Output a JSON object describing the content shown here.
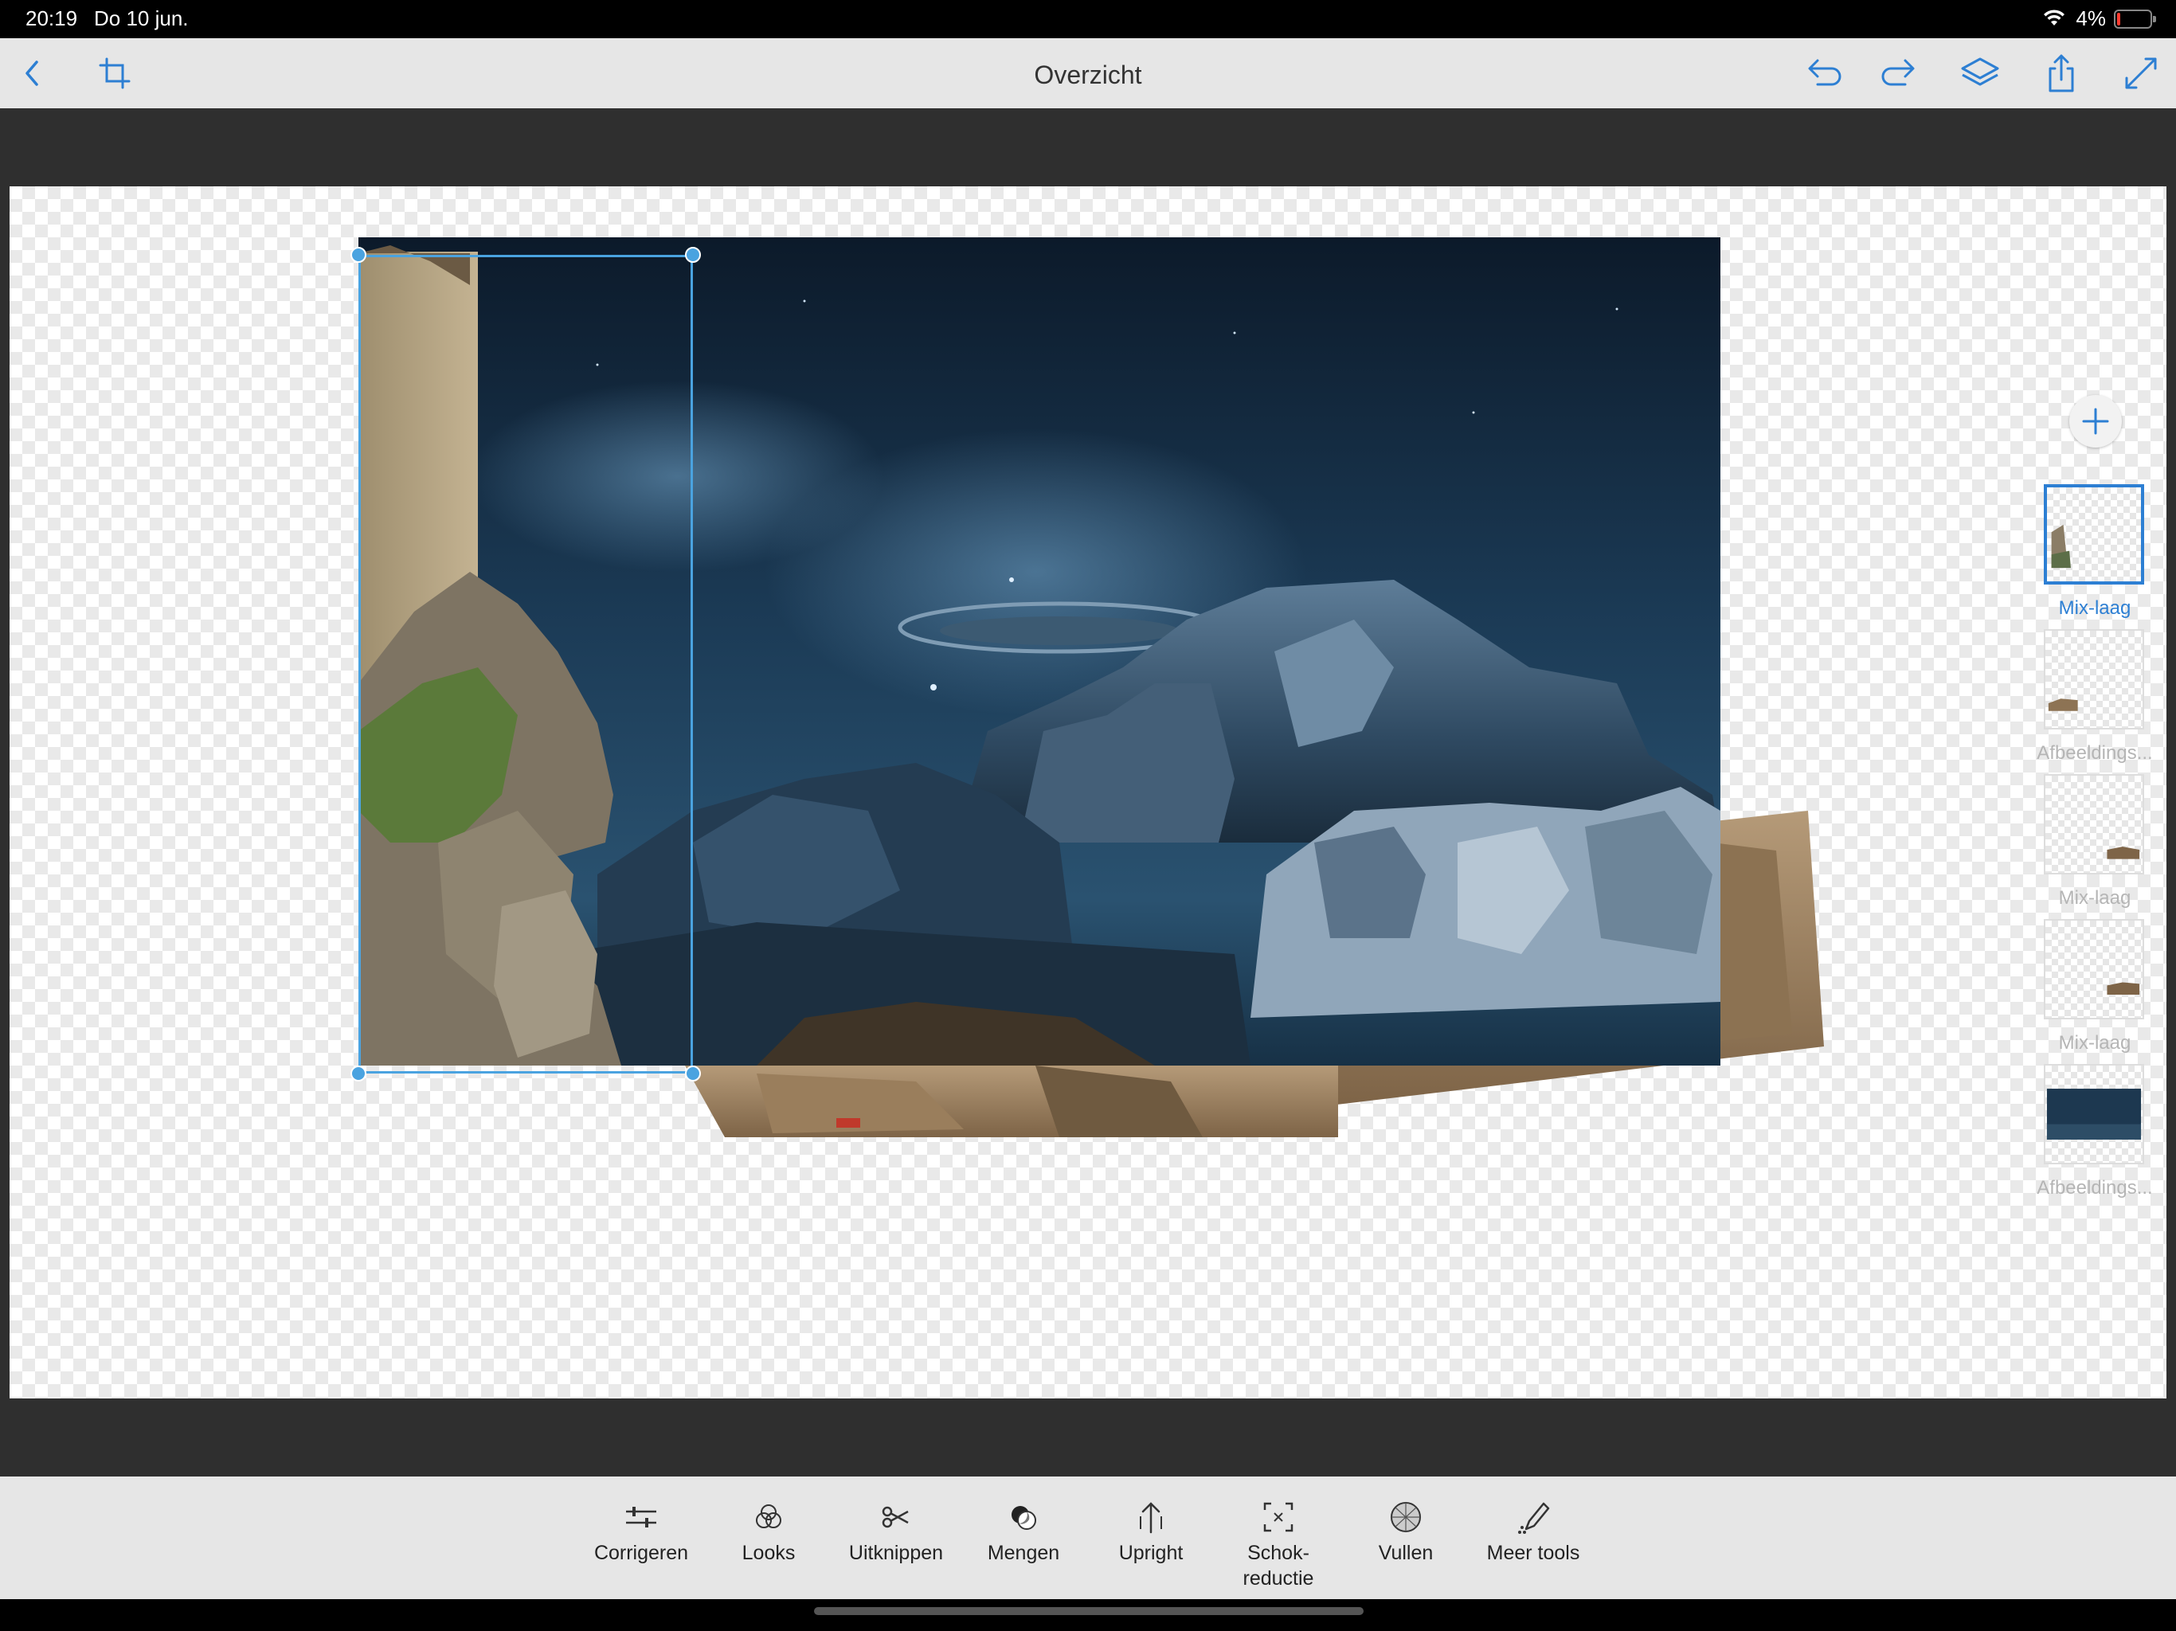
{
  "status_bar": {
    "time": "20:19",
    "date": "Do 10 jun.",
    "battery_text": "4%",
    "battery_level": 0.04
  },
  "toolbar": {
    "title": "Overzicht",
    "left_icons": [
      "back-chevron-icon",
      "crop-icon"
    ],
    "right_icons": [
      "undo-icon",
      "redo-icon",
      "layers-icon",
      "share-icon",
      "fullscreen-icon"
    ]
  },
  "colors": {
    "accent": "#2d7fd3",
    "toolbar_bg": "#e6e6e6",
    "workspace_bg": "#2f2f2f"
  },
  "layers": {
    "add_icon": "plus-icon",
    "items": [
      {
        "label": "Mix-laag",
        "selected": true
      },
      {
        "label": "Afbeeldings...",
        "selected": false
      },
      {
        "label": "Mix-laag",
        "selected": false
      },
      {
        "label": "Mix-laag",
        "selected": false
      },
      {
        "label": "Afbeeldings...",
        "selected": false
      }
    ]
  },
  "tools": [
    {
      "label": "Corrigeren",
      "icon": "sliders-icon"
    },
    {
      "label": "Looks",
      "icon": "circles-icon"
    },
    {
      "label": "Uitknippen",
      "icon": "scissors-icon"
    },
    {
      "label": "Mengen",
      "icon": "blend-icon"
    },
    {
      "label": "Upright",
      "icon": "upright-arrow-icon"
    },
    {
      "label": "Schok-",
      "label2": "reductie",
      "icon": "shake-reduction-icon"
    },
    {
      "label": "Vullen",
      "icon": "fill-icon"
    },
    {
      "label": "Meer tools",
      "icon": "pencil-icon"
    }
  ]
}
